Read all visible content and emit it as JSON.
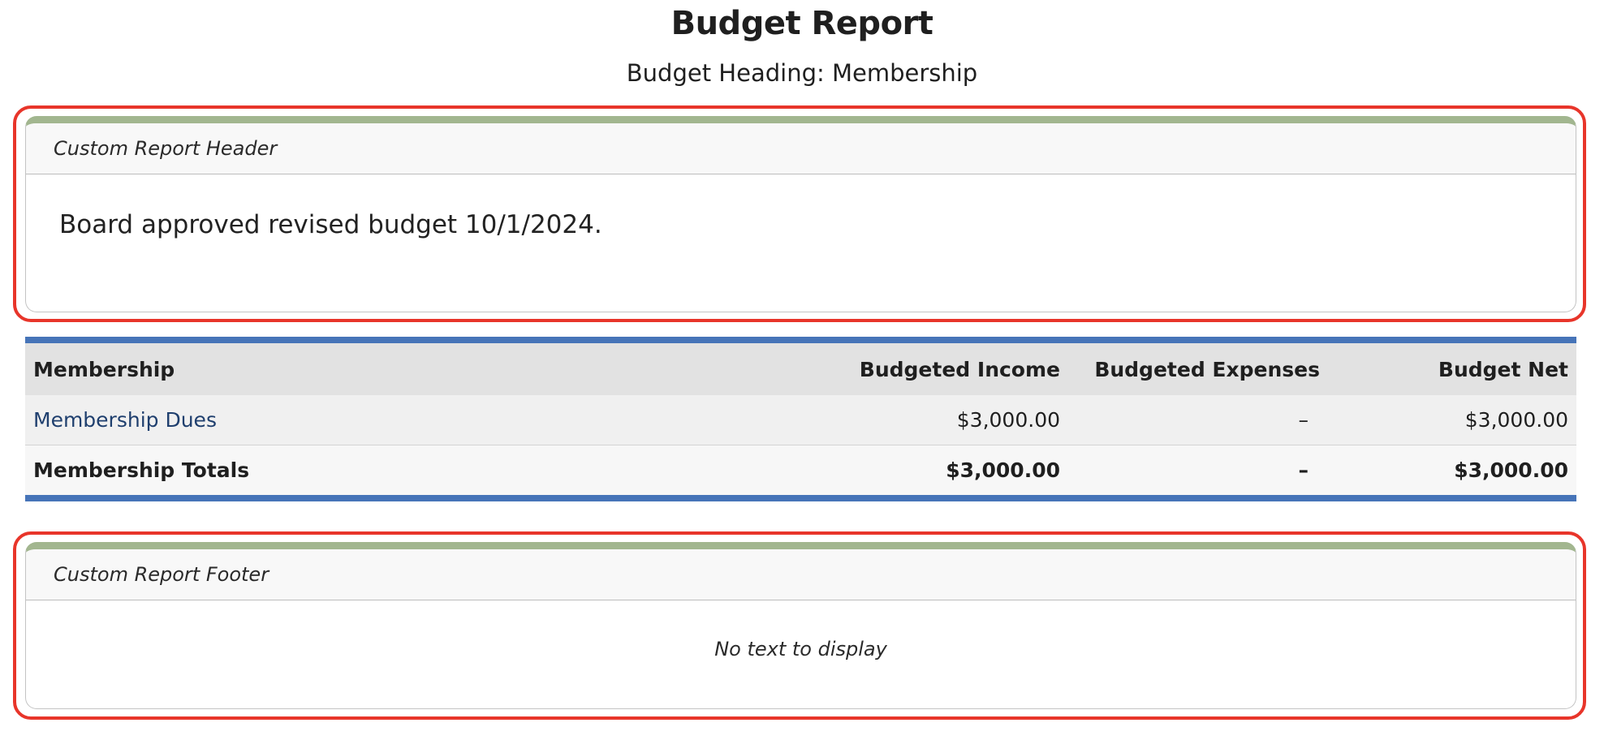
{
  "report": {
    "title": "Budget Report",
    "subtitle": "Budget Heading: Membership"
  },
  "header_panel": {
    "title": "Custom Report Header",
    "body": "Board approved revised budget 10/1/2024."
  },
  "table": {
    "columns": [
      "Membership",
      "Budgeted Income",
      "Budgeted Expenses",
      "Budget Net"
    ],
    "rows": [
      {
        "name": "Membership Dues",
        "income": "$3,000.00",
        "expenses": "–",
        "net": "$3,000.00"
      }
    ],
    "totals": {
      "name": "Membership Totals",
      "income": "$3,000.00",
      "expenses": "–",
      "net": "$3,000.00"
    }
  },
  "footer_panel": {
    "title": "Custom Report Footer",
    "body": "No text to display"
  },
  "colors": {
    "highlight": "#e8352a",
    "panel_accent": "#a2b68f",
    "table_accent": "#4674b8",
    "link": "#1f3f6e"
  }
}
